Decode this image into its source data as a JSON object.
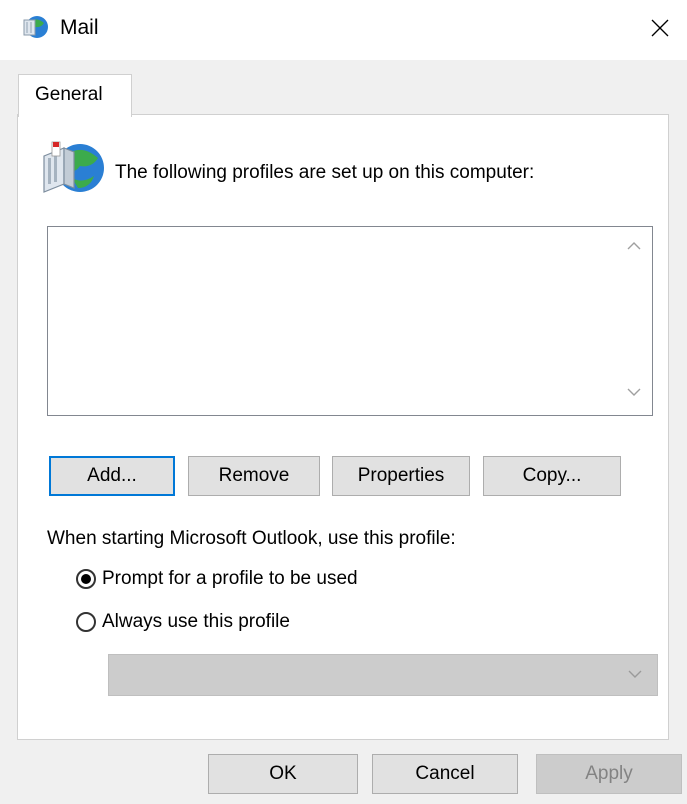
{
  "window": {
    "title": "Mail",
    "icon": "mail-globe-icon",
    "close_icon": "close-icon"
  },
  "tabs": [
    {
      "label": "General",
      "selected": true
    }
  ],
  "general": {
    "profiles_label": "The following profiles are set up on this computer:",
    "profiles": [],
    "buttons": {
      "add": "Add...",
      "remove": "Remove",
      "properties": "Properties",
      "copy": "Copy..."
    },
    "startup_label": "When starting Microsoft Outlook, use this profile:",
    "radio_prompt": {
      "label": "Prompt for a profile to be used",
      "checked": true
    },
    "radio_always": {
      "label": "Always use this profile",
      "checked": false
    },
    "profile_select": {
      "value": "",
      "disabled": true
    }
  },
  "footer": {
    "ok": "OK",
    "cancel": "Cancel",
    "apply": "Apply",
    "apply_disabled": true
  },
  "colors": {
    "accent": "#0078d7",
    "dialog_bg": "#f0f0f0",
    "disabled_bg": "#cccccc"
  }
}
